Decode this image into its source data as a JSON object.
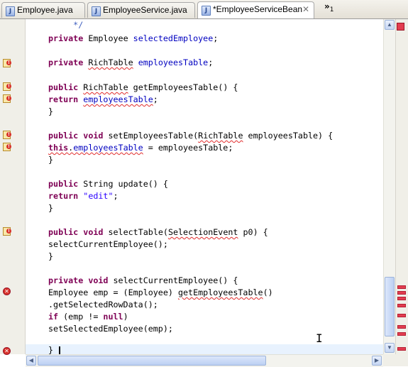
{
  "tabs": [
    {
      "label": "Employee.java",
      "active": false
    },
    {
      "label": "EmployeeService.java",
      "active": false
    },
    {
      "label": "*EmployeeServiceBean",
      "active": true
    }
  ],
  "tab_close_glyph": "✕",
  "tab_overflow": {
    "glyph": "»",
    "count": "1"
  },
  "code_lines": [
    {
      "kind": "comment",
      "text": "     */"
    },
    {
      "kind": "field_decl",
      "kw": "private",
      "type": "Employee",
      "name": "selectedEmployee",
      "end": ";"
    },
    {
      "kind": "field_decl_err",
      "kw": "private",
      "type": "RichTable",
      "name": "employeesTable",
      "end": ";"
    },
    {
      "kind": "method_sig",
      "kw": "public",
      "type": "RichTable",
      "rest": " getEmployeesTable() {"
    },
    {
      "kind": "return_field",
      "kw": "return",
      "name": "employeesTable",
      "end": ";"
    },
    {
      "kind": "plain",
      "text": "}"
    },
    {
      "kind": "setter_sig",
      "kw1": "public",
      "kw2": "void",
      "pre": "setEmployeesTable(",
      "type": "RichTable",
      "post": " employeesTable) {"
    },
    {
      "kind": "this_assign",
      "kw": "this",
      "dot": ".",
      "name": "employeesTable",
      "rest": " = employeesTable;"
    },
    {
      "kind": "plain",
      "text": "}"
    },
    {
      "kind": "string_method",
      "kw": "public",
      "rest": " String update() {"
    },
    {
      "kind": "return_string",
      "kw": "return",
      "str": "\"edit\"",
      "end": ";"
    },
    {
      "kind": "plain",
      "text": "}"
    },
    {
      "kind": "select_sig",
      "kw1": "public",
      "kw2": "void",
      "pre": "selectTable(",
      "type": "SelectionEvent",
      "post": " p0) {"
    },
    {
      "kind": "plain",
      "text": "selectCurrentEmployee();"
    },
    {
      "kind": "plain",
      "text": "}"
    },
    {
      "kind": "private_void",
      "kw1": "private",
      "kw2": "void",
      "rest": " selectCurrentEmployee() {"
    },
    {
      "kind": "emp_assign",
      "pre": "Employee emp = (Employee) ",
      "call": "getEmployeesTable",
      "post": "()"
    },
    {
      "kind": "plain",
      "text": ".getSelectedRowData();"
    },
    {
      "kind": "if_null",
      "kw1": "if",
      "mid": " (emp != ",
      "kw2": "null",
      "post": ")"
    },
    {
      "kind": "plain",
      "text": "setSelectedEmployee(emp);"
    },
    {
      "kind": "plain",
      "text": "}"
    }
  ],
  "gutter_icons": [
    "warning-icon",
    "warning-icon",
    "warning-icon",
    "warning-icon",
    "warning-icon",
    "warning-icon",
    "warning-icon",
    "error-icon",
    "error-icon"
  ],
  "colors": {
    "keyword": "#7f0055",
    "field": "#0000c0",
    "string": "#2a00ff",
    "comment": "#3f5fbf",
    "error": "#e12b2b"
  }
}
